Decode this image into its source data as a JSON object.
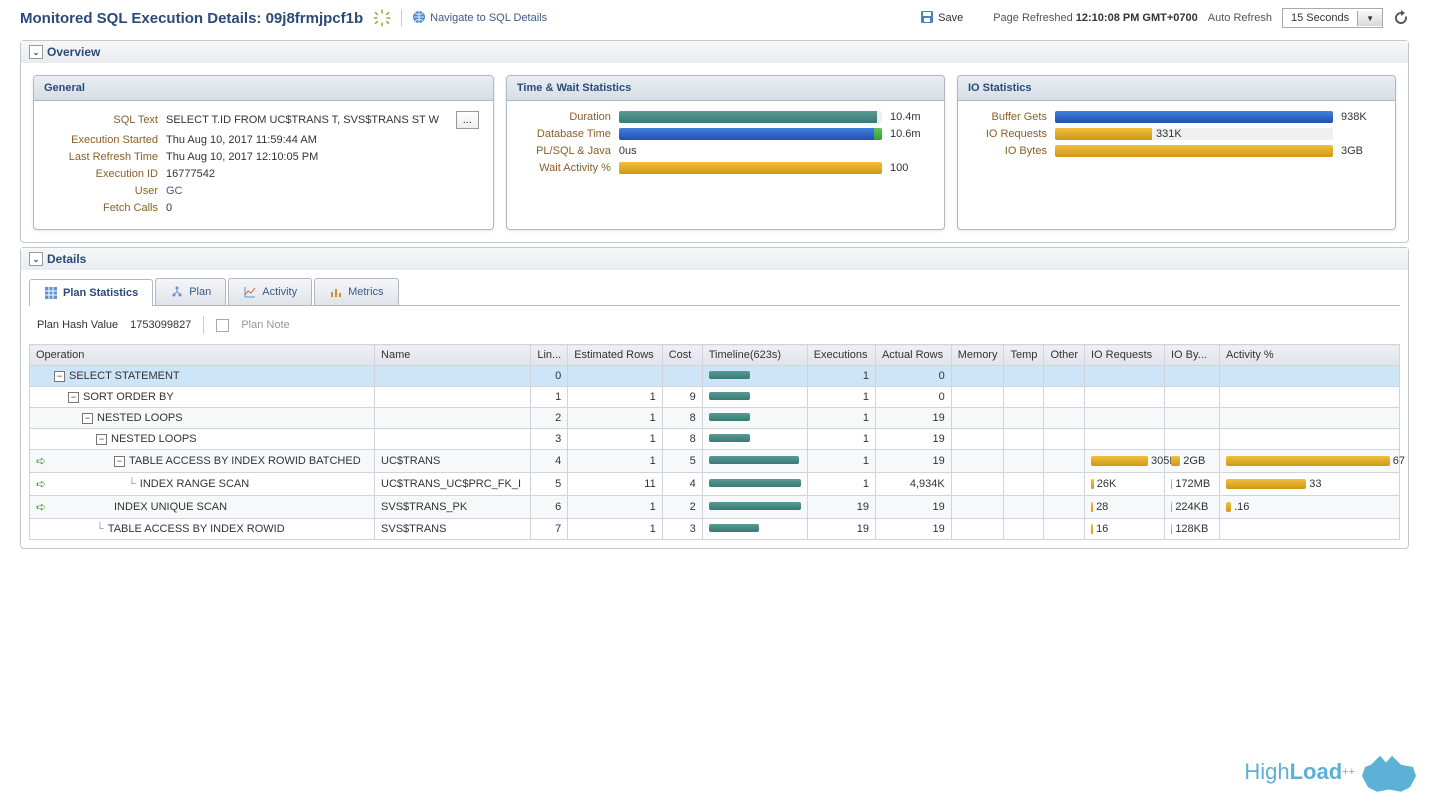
{
  "header": {
    "title": "Monitored SQL Execution Details: 09j8frmjpcf1b",
    "nav_link": "Navigate to SQL Details",
    "save": "Save",
    "page_refreshed": "Page Refreshed",
    "refresh_time": "12:10:08 PM GMT+0700",
    "auto_refresh": "Auto Refresh",
    "interval": "15 Seconds"
  },
  "overview": {
    "title": "Overview",
    "general": {
      "title": "General",
      "sql_text_label": "SQL Text",
      "sql_text": "SELECT T.ID FROM UC$TRANS T, SVS$TRANS ST W",
      "exec_started_label": "Execution Started",
      "exec_started": "Thu Aug 10, 2017 11:59:44 AM",
      "last_refresh_label": "Last Refresh Time",
      "last_refresh": "Thu Aug 10, 2017 12:10:05 PM",
      "exec_id_label": "Execution ID",
      "exec_id": "16777542",
      "user_label": "User",
      "user": "GC",
      "fetch_calls_label": "Fetch Calls",
      "fetch_calls": "0"
    },
    "time_wait": {
      "title": "Time & Wait Statistics",
      "duration_label": "Duration",
      "duration_val": "10.4m",
      "db_time_label": "Database Time",
      "db_time_val": "10.6m",
      "plsql_label": "PL/SQL & Java",
      "plsql_val": "0us",
      "wait_label": "Wait Activity %",
      "wait_val": "100"
    },
    "io": {
      "title": "IO Statistics",
      "buffer_gets_label": "Buffer Gets",
      "buffer_gets_val": "938K",
      "io_req_label": "IO Requests",
      "io_req_val": "331K",
      "io_bytes_label": "IO Bytes",
      "io_bytes_val": "3GB"
    }
  },
  "details": {
    "title": "Details",
    "tabs": {
      "plan_stats": "Plan Statistics",
      "plan": "Plan",
      "activity": "Activity",
      "metrics": "Metrics"
    },
    "plan_hash_label": "Plan Hash Value",
    "plan_hash": "1753099827",
    "plan_note": "Plan Note",
    "columns": {
      "operation": "Operation",
      "name": "Name",
      "line": "Lin...",
      "est_rows": "Estimated Rows",
      "cost": "Cost",
      "timeline": "Timeline(623s)",
      "executions": "Executions",
      "actual_rows": "Actual Rows",
      "memory": "Memory",
      "temp": "Temp",
      "other": "Other",
      "io_req": "IO Requests",
      "io_bytes": "IO By...",
      "activity": "Activity %"
    },
    "rows": [
      {
        "op": "SELECT STATEMENT",
        "indent": 1,
        "expand": true,
        "name": "",
        "line": "0",
        "est": "",
        "cost": "",
        "tl_start": 0,
        "tl_w": 45,
        "exec": "1",
        "actual": "0",
        "ioreq": "",
        "ioby": "",
        "act": "",
        "sel": true
      },
      {
        "op": "SORT ORDER BY",
        "indent": 2,
        "expand": true,
        "name": "",
        "line": "1",
        "est": "1",
        "cost": "9",
        "tl_start": 0,
        "tl_w": 45,
        "exec": "1",
        "actual": "0",
        "ioreq": "",
        "ioby": "",
        "act": ""
      },
      {
        "op": "NESTED LOOPS",
        "indent": 3,
        "expand": true,
        "name": "",
        "line": "2",
        "est": "1",
        "cost": "8",
        "tl_start": 0,
        "tl_w": 45,
        "exec": "1",
        "actual": "19",
        "ioreq": "",
        "ioby": "",
        "act": ""
      },
      {
        "op": "NESTED LOOPS",
        "indent": 4,
        "expand": true,
        "name": "",
        "line": "3",
        "est": "1",
        "cost": "8",
        "tl_start": 0,
        "tl_w": 45,
        "exec": "1",
        "actual": "19",
        "ioreq": "",
        "ioby": "",
        "act": ""
      },
      {
        "op": "TABLE ACCESS BY INDEX ROWID BATCHED",
        "indent": 5,
        "expand": true,
        "arrow": true,
        "name": "UC$TRANS",
        "line": "4",
        "est": "1",
        "cost": "5",
        "tl_start": 0,
        "tl_w": 98,
        "exec": "1",
        "actual": "19",
        "ioreq": "305K",
        "ioreq_w": 85,
        "ioby": "2GB",
        "ioby_w": 22,
        "act": "67",
        "act_w": 98
      },
      {
        "op": "INDEX RANGE SCAN",
        "indent": 6,
        "line_pre": true,
        "arrow": true,
        "name": "UC$TRANS_UC$PRC_FK_I",
        "line": "5",
        "est": "11",
        "cost": "4",
        "tl_start": 0,
        "tl_w": 100,
        "exec": "1",
        "actual": "4,934K",
        "ioreq": "26K",
        "ioreq_w": 4,
        "ioby": "172MB",
        "act": "33",
        "act_w": 48
      },
      {
        "op": "INDEX UNIQUE SCAN",
        "indent": 5,
        "arrow": true,
        "name": "SVS$TRANS_PK",
        "line": "6",
        "est": "1",
        "cost": "2",
        "tl_start": 0,
        "tl_w": 100,
        "exec": "19",
        "actual": "19",
        "ioreq": "28",
        "ioreq_w": 3,
        "ioby": "224KB",
        "act": ".16",
        "act_w": 3
      },
      {
        "op": "TABLE ACCESS BY INDEX ROWID",
        "indent": 4,
        "line_pre": true,
        "name": "SVS$TRANS",
        "line": "7",
        "est": "1",
        "cost": "3",
        "tl_start": 0,
        "tl_w": 55,
        "exec": "19",
        "actual": "19",
        "ioreq": "16",
        "ioreq_w": 3,
        "ioby": "128KB",
        "act": ""
      }
    ]
  },
  "logo": {
    "text1": "High",
    "text2": "Load",
    "sup": "++"
  },
  "chart_data": {
    "type": "bar",
    "note": "Horizontal stat bars",
    "time_wait": [
      {
        "label": "Duration",
        "value": 10.4,
        "unit": "m",
        "pct": 98,
        "color": "teal"
      },
      {
        "label": "Database Time",
        "value": 10.6,
        "unit": "m",
        "pct": 100,
        "color": "blue",
        "tail_green_pct": 3
      },
      {
        "label": "PL/SQL & Java",
        "value": 0,
        "unit": "us",
        "pct": 0
      },
      {
        "label": "Wait Activity %",
        "value": 100,
        "unit": "",
        "pct": 100,
        "color": "orange"
      }
    ],
    "io": [
      {
        "label": "Buffer Gets",
        "value": 938000,
        "display": "938K",
        "pct": 100,
        "color": "blue"
      },
      {
        "label": "IO Requests",
        "value": 331000,
        "display": "331K",
        "pct": 35,
        "color": "orange"
      },
      {
        "label": "IO Bytes",
        "value": 3,
        "unit": "GB",
        "display": "3GB",
        "pct": 100,
        "color": "orange"
      }
    ]
  }
}
